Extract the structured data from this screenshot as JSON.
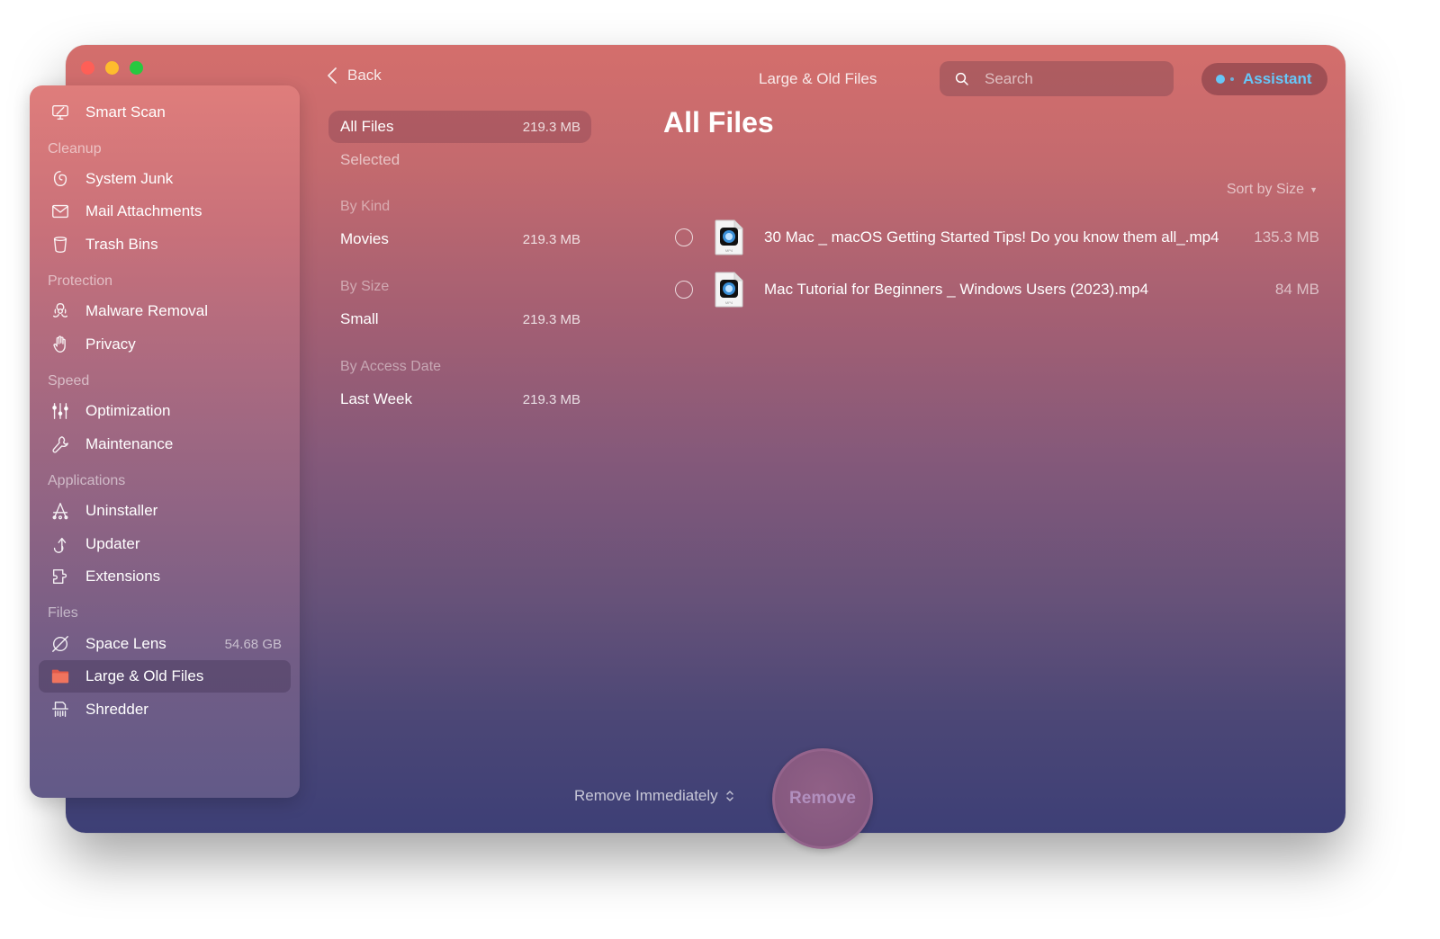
{
  "window": {
    "title": "Large & Old Files",
    "traffic_lights": [
      "close",
      "minimize",
      "zoom"
    ]
  },
  "sidebar": {
    "top_item": {
      "label": "Smart Scan",
      "icon": "monitor-scan-icon"
    },
    "sections": [
      {
        "title": "Cleanup",
        "items": [
          {
            "label": "System Junk",
            "icon": "system-junk-icon"
          },
          {
            "label": "Mail Attachments",
            "icon": "mail-icon"
          },
          {
            "label": "Trash Bins",
            "icon": "trash-icon"
          }
        ]
      },
      {
        "title": "Protection",
        "items": [
          {
            "label": "Malware Removal",
            "icon": "biohazard-icon"
          },
          {
            "label": "Privacy",
            "icon": "hand-icon"
          }
        ]
      },
      {
        "title": "Speed",
        "items": [
          {
            "label": "Optimization",
            "icon": "sliders-icon"
          },
          {
            "label": "Maintenance",
            "icon": "wrench-icon"
          }
        ]
      },
      {
        "title": "Applications",
        "items": [
          {
            "label": "Uninstaller",
            "icon": "uninstaller-icon"
          },
          {
            "label": "Updater",
            "icon": "updater-arrow-icon"
          },
          {
            "label": "Extensions",
            "icon": "puzzle-icon"
          }
        ]
      },
      {
        "title": "Files",
        "items": [
          {
            "label": "Space Lens",
            "icon": "planet-icon",
            "value": "54.68 GB"
          },
          {
            "label": "Large & Old Files",
            "icon": "folder-icon",
            "active": true
          },
          {
            "label": "Shredder",
            "icon": "shredder-icon"
          }
        ]
      }
    ]
  },
  "toolbar": {
    "back_label": "Back",
    "search_placeholder": "Search",
    "assistant_label": "Assistant",
    "assistant_color": "#67c6f7"
  },
  "categories": {
    "all_files": {
      "label": "All Files",
      "value": "219.3 MB"
    },
    "selected": {
      "label": "Selected"
    },
    "groups": [
      {
        "title": "By Kind",
        "items": [
          {
            "label": "Movies",
            "value": "219.3 MB"
          }
        ]
      },
      {
        "title": "By Size",
        "items": [
          {
            "label": "Small",
            "value": "219.3 MB"
          }
        ]
      },
      {
        "title": "By Access Date",
        "items": [
          {
            "label": "Last Week",
            "value": "219.3 MB"
          }
        ]
      }
    ]
  },
  "main": {
    "title": "All Files",
    "sort_label": "Sort by Size",
    "files": [
      {
        "name": "30 Mac _ macOS Getting Started Tips! Do you know them all_.mp4",
        "size": "135.3 MB",
        "type": "MP4",
        "checked": false
      },
      {
        "name": "Mac Tutorial for Beginners _ Windows Users (2023).mp4",
        "size": "84 MB",
        "type": "MP4",
        "checked": false
      }
    ]
  },
  "footer": {
    "remove_mode": "Remove Immediately",
    "remove_button": "Remove"
  }
}
